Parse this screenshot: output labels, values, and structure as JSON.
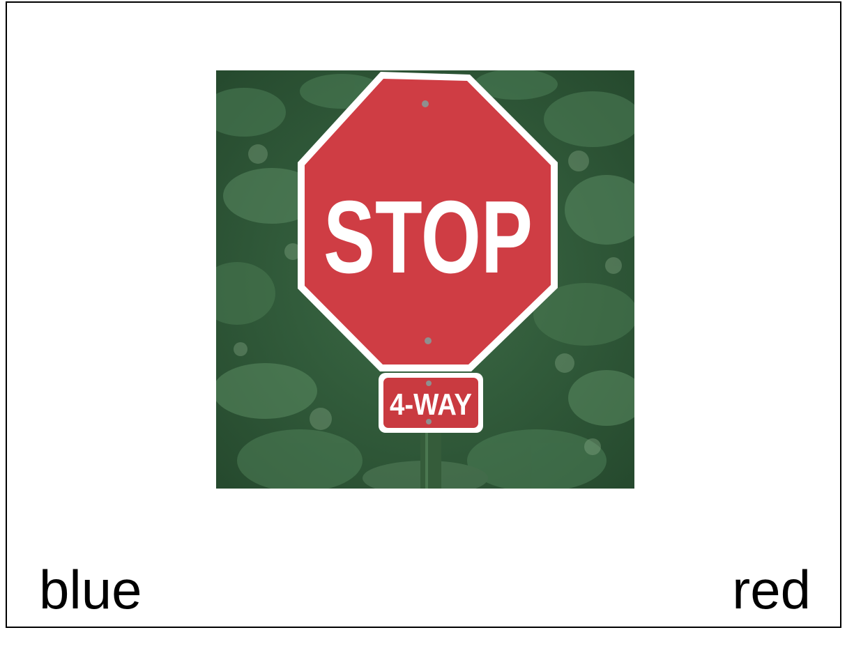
{
  "photo": {
    "subject": "stop-sign",
    "sign_text": "STOP",
    "plate_text": "4-WAY",
    "sign_color": "#cf3d44",
    "foliage_color": "#2f5a38"
  },
  "options": {
    "left": "blue",
    "right": "red"
  }
}
